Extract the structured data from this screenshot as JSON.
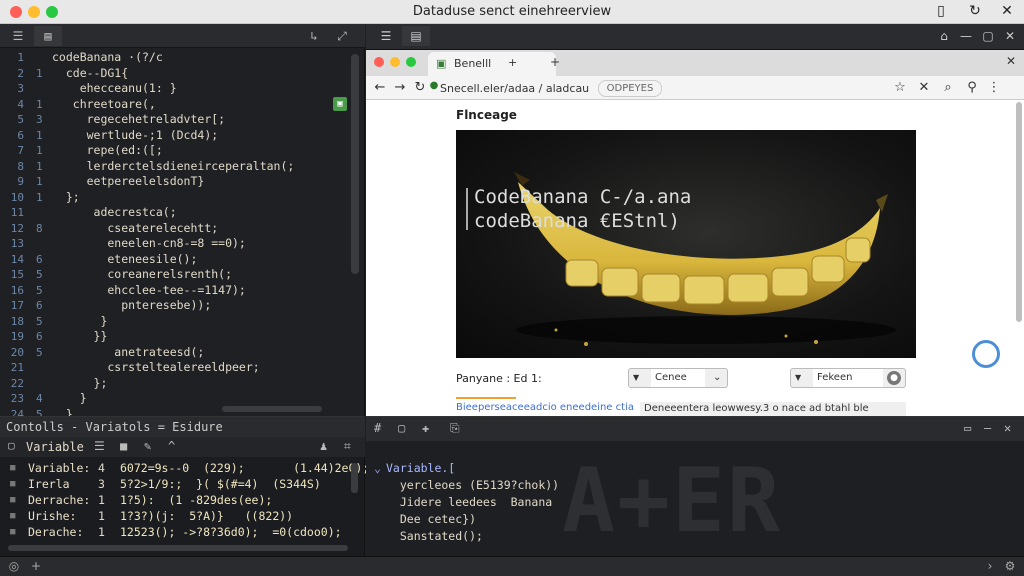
{
  "window": {
    "title": "Dataduse senct einehreerview"
  },
  "editor": {
    "line_numbers": [
      "1",
      "2",
      "3",
      "4",
      "5",
      "6",
      "7",
      "8",
      "9",
      "10",
      "11",
      "12",
      "13",
      "14",
      "15",
      "16",
      "17",
      "18",
      "19",
      "20",
      "21",
      "22",
      "23",
      "24",
      "25",
      "26"
    ],
    "fold_column": [
      "",
      "1",
      "",
      "1",
      "3",
      "1",
      "1",
      "1",
      "1",
      "1",
      "",
      "8",
      "",
      "6",
      "5",
      "5",
      "6",
      "5",
      "6",
      "5",
      "",
      "",
      "4",
      "5",
      "",
      ""
    ],
    "lines": [
      "codeBanana ·(?/c",
      "  cde--DG1{",
      "    ehecceanu(1: }",
      "   chreetoare(,",
      "     regecehetreladvter[;",
      "     wertlude-;1 (Dcd4);",
      "     repe(ed:([;",
      "     lerderctelsdieneirceperaltan(;",
      "     eetpereelelsdonT}",
      "  };",
      "      adecrestca(;",
      "        cseaterelecehtt;",
      "        eneelen-cn8-=8 ==0);",
      "        eteneesile();",
      "        coreanerelsrenth(;",
      "        ehcclee-tee--=1147);",
      "          pnteresebe));",
      "       }",
      "      }}",
      "         anetrateesd(;",
      "        csrsteltealereeldpeer;",
      "      };",
      "    }",
      "  }"
    ]
  },
  "browser": {
    "tab_title": "Benelll",
    "new_tab": "+",
    "url": "Snecell.eler/adaa / aladcau",
    "url_chip": "ODPEYES",
    "page_heading": "Flnceage",
    "hero_line1": "CodeBanana C-/a.ana",
    "hero_line2": "codeBanana €EStnl)",
    "form_label": "Panyane : Ed 1:",
    "select1": "Cenee",
    "select2": "Fekeen",
    "link_text": "Bieeperseaceeadcio eneedeine ctia",
    "note_text": "Deneeentera leowwesy.3 o nace ad btahl ble"
  },
  "console": {
    "tabs_label": "Contolls - Variatols = Esidure",
    "toolbar_label": "Variable",
    "rows": [
      {
        "name": "Variable:",
        "idx": "4",
        "value": "6072=9s--0  (229);       (1.44)2e0);"
      },
      {
        "name": "Irerla",
        "idx": "3",
        "value": "5?2>1/9:;  }( $(#=4)  (S344S)"
      },
      {
        "name": "Derrache:",
        "idx": "1",
        "value": "1?5):  (1 -829des(ee);"
      },
      {
        "name": "Urishe:",
        "idx": "1",
        "value": "1?3?)(j:  5?A)}   ((822))"
      },
      {
        "name": "Derache:",
        "idx": "1",
        "value": "12523(); ->?8?36d0);  =0(cdoo0);"
      }
    ]
  },
  "panel": {
    "watermark": "A+ER",
    "rows": [
      "Variable.[",
      "  yercleoes (E5139?chok))",
      "  Jidere leedees  Banana",
      "  Dee cetec})",
      "  Sanstated();"
    ]
  }
}
